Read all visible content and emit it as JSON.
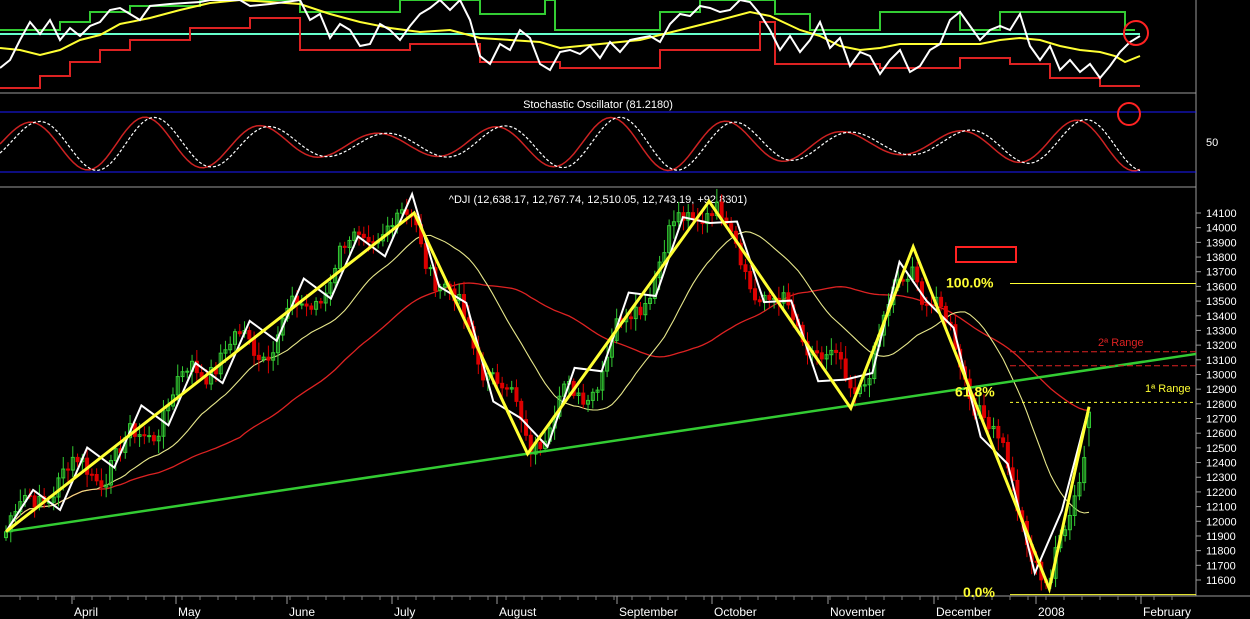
{
  "panels": {
    "oscillator_title": "Stochastic Oscillator (81.2180)",
    "oscillator_level": "50",
    "price_title": "^DJI (12,638.17, 12,767.74, 12,510.05, 12,743.19, +92.8301)"
  },
  "annotations": {
    "fib_100": "100.0%",
    "fib_618": "61.8%",
    "fib_0": "0.0%",
    "range_1": "1ª Range",
    "range_2": "2ª Range"
  },
  "colors": {
    "background": "#000000",
    "bull_candle": "#33cc33",
    "bear_candle": "#dd0000",
    "zigzag_major": "#ffff33",
    "zigzag_minor": "#ffffff",
    "trendline": "#33cc33",
    "guide_line": "#66ffcc",
    "panel_border": "#1a1aff",
    "stoch_k": "#cc2222",
    "stoch_d": "#ffffff",
    "ma_fast": "#e6e68a",
    "ma_slow": "#dd2222",
    "circle": "#ff2222"
  },
  "chart_data": {
    "type": "candlestick",
    "title": "^DJI",
    "x_labels": [
      "April",
      "May",
      "June",
      "July",
      "August",
      "September",
      "October",
      "November",
      "December",
      "2008",
      "February"
    ],
    "y_ticks": [
      14100,
      14000,
      13900,
      13800,
      13700,
      13600,
      13500,
      13400,
      13300,
      13200,
      13100,
      13000,
      12900,
      12800,
      12700,
      12600,
      12500,
      12400,
      12300,
      12200,
      12100,
      12000,
      11900,
      11800,
      11700,
      11600
    ],
    "ylim": [
      11500,
      14200
    ],
    "last_bar": {
      "open": 12638.17,
      "high": 12767.74,
      "low": 12510.05,
      "close": 12743.19,
      "change": 92.8301
    },
    "stochastic_value": 81.218,
    "zigzag_yellow": [
      {
        "t": 0.0,
        "v": 11930
      },
      {
        "t": 0.36,
        "v": 14100
      },
      {
        "t": 0.46,
        "v": 12460
      },
      {
        "t": 0.62,
        "v": 14180
      },
      {
        "t": 0.745,
        "v": 12770
      },
      {
        "t": 0.8,
        "v": 13870
      },
      {
        "t": 0.92,
        "v": 11540
      },
      {
        "t": 0.955,
        "v": 12780
      }
    ],
    "fibonacci": [
      {
        "label": "100.0%",
        "value": 13620
      },
      {
        "label": "61.8%",
        "value": 12810
      },
      {
        "label": "0.0%",
        "value": 11500
      }
    ],
    "ranges": [
      {
        "label": "1ª Range",
        "value": 12820
      },
      {
        "label": "2ª Range",
        "value": 13100
      }
    ],
    "trendline": [
      {
        "t": 0.0,
        "v": 11930
      },
      {
        "t": 1.0,
        "v": 13140
      }
    ]
  }
}
